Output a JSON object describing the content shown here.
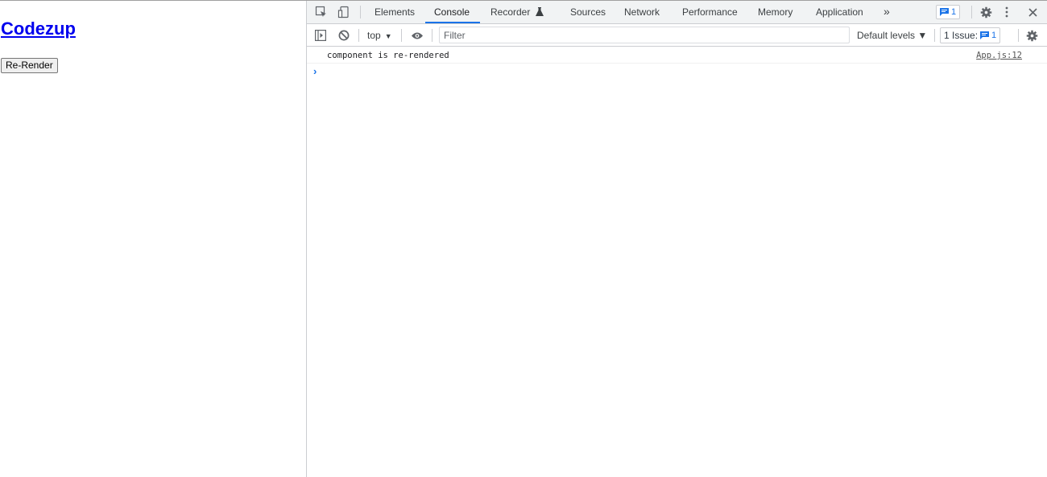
{
  "page": {
    "title": "Codezup",
    "button_label": "Re-Render"
  },
  "devtools": {
    "tabs": [
      {
        "label": "Elements",
        "active": false
      },
      {
        "label": "Console",
        "active": true
      },
      {
        "label": "Recorder",
        "active": false
      },
      {
        "label": "Sources",
        "active": false
      },
      {
        "label": "Network",
        "active": false
      },
      {
        "label": "Performance",
        "active": false
      },
      {
        "label": "Memory",
        "active": false
      },
      {
        "label": "Application",
        "active": false
      }
    ],
    "more_tabs": "»",
    "message_badge_count": "1",
    "toolbar": {
      "context": "top",
      "filter_placeholder": "Filter",
      "levels": "Default levels ▼",
      "issues_label": "1 Issue:",
      "issues_count": "1"
    },
    "console_messages": [
      {
        "text": "component is re-rendered",
        "source": "App.js:12"
      }
    ],
    "prompt_symbol": "›"
  },
  "colors": {
    "accent": "#1a73e8",
    "link": "#0000ee",
    "panel_bg": "#f1f3f4",
    "border": "#cbcdd1"
  },
  "icons": [
    "inspect-element-icon",
    "device-toggle-icon",
    "recorder-flask-icon",
    "message-icon",
    "settings-gear-icon",
    "kebab-menu-icon",
    "close-icon",
    "sidebar-toggle-icon",
    "clear-console-icon",
    "eye-icon",
    "issue-icon"
  ]
}
